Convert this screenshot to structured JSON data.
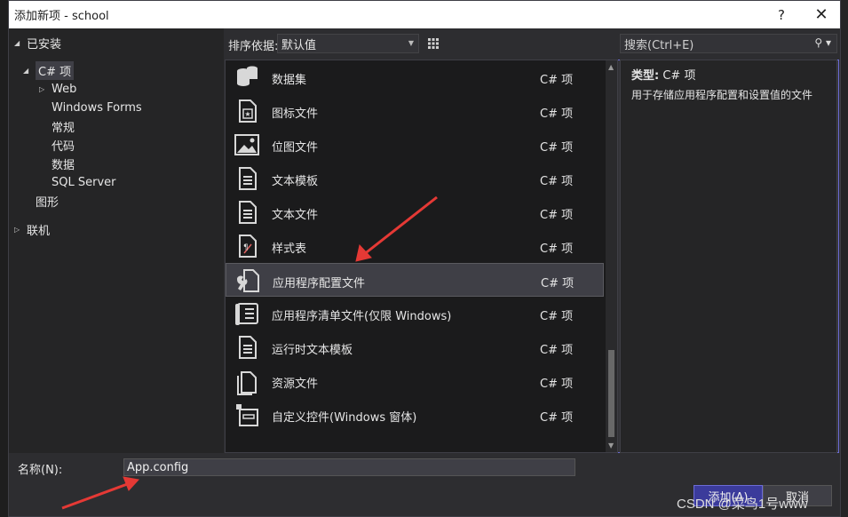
{
  "dialog": {
    "title": "添加新项 - school",
    "help_label": "?",
    "close_label": "✕"
  },
  "tree": {
    "installed": "已安装",
    "csharp": "C# 项",
    "web": "Web",
    "winforms": "Windows Forms",
    "general": "常规",
    "code": "代码",
    "data": "数据",
    "sqlserver": "SQL Server",
    "graphics": "图形",
    "online": "联机"
  },
  "toolbar": {
    "sort_label": "排序依据:",
    "sort_value": "默认值"
  },
  "items": [
    {
      "name": "数据集",
      "kind": "C# 项",
      "icon": "dataset-icon"
    },
    {
      "name": "图标文件",
      "kind": "C# 项",
      "icon": "icon-file-icon"
    },
    {
      "name": "位图文件",
      "kind": "C# 项",
      "icon": "bitmap-icon"
    },
    {
      "name": "文本模板",
      "kind": "C# 项",
      "icon": "text-template-icon"
    },
    {
      "name": "文本文件",
      "kind": "C# 项",
      "icon": "text-file-icon"
    },
    {
      "name": "样式表",
      "kind": "C# 项",
      "icon": "stylesheet-icon"
    },
    {
      "name": "应用程序配置文件",
      "kind": "C# 项",
      "icon": "app-config-icon",
      "selected": true
    },
    {
      "name": "应用程序清单文件(仅限 Windows)",
      "kind": "C# 项",
      "icon": "manifest-icon"
    },
    {
      "name": "运行时文本模板",
      "kind": "C# 项",
      "icon": "runtime-template-icon"
    },
    {
      "name": "资源文件",
      "kind": "C# 项",
      "icon": "resource-file-icon"
    },
    {
      "name": "自定义控件(Windows 窗体)",
      "kind": "C# 项",
      "icon": "custom-control-icon"
    }
  ],
  "search": {
    "placeholder": "搜索(Ctrl+E)"
  },
  "details": {
    "type_label": "类型:",
    "type_value": "C# 项",
    "description": "用于存储应用程序配置和设置值的文件"
  },
  "footer": {
    "name_label": "名称(N):",
    "name_value": "App.config",
    "add_label": "添加(A)",
    "cancel_label": "取消"
  },
  "watermark": "CSDN @菜鸟1号www",
  "colors": {
    "accent": "#6c6cd6",
    "annotation": "#e53935"
  }
}
